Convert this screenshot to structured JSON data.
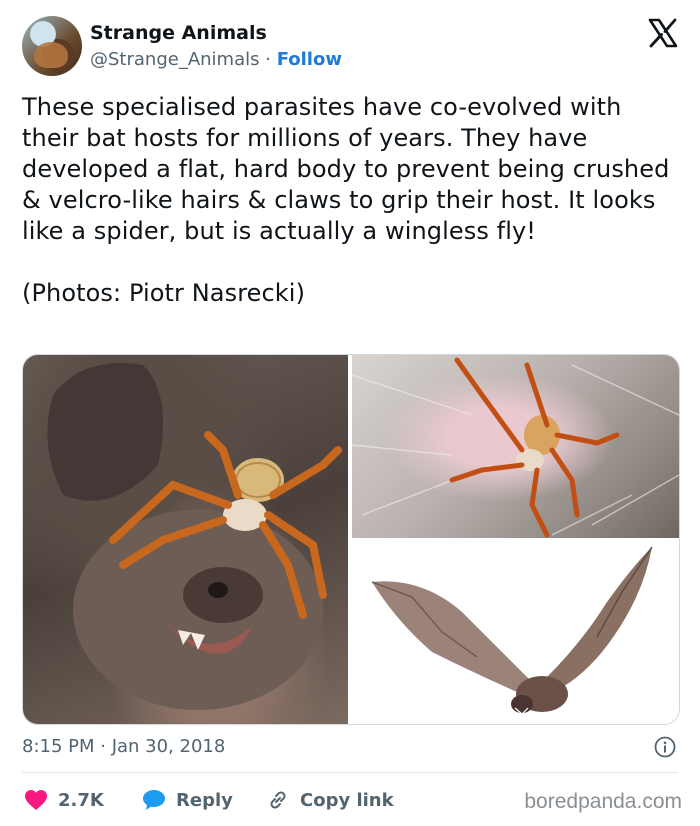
{
  "header": {
    "display_name": "Strange Animals",
    "handle": "@Strange_Animals",
    "separator": "·",
    "follow_label": "Follow"
  },
  "icons": {
    "platform": "x-logo-icon",
    "info": "info-icon",
    "like": "heart-icon",
    "reply": "speech-bubble-icon",
    "copy": "link-icon"
  },
  "tweet": {
    "paragraph1": "These specialised parasites have co-evolved with their bat hosts for millions of years. They have developed a flat, hard body to prevent being crushed & velcro-like hairs & claws to grip their host. It looks like a spider, but is actually a wingless fly!",
    "paragraph2": "(Photos: Piotr Nasrecki)"
  },
  "media": {
    "photos": [
      "bat-fly-on-bat-face",
      "bat-fly-in-fur",
      "flying-bat"
    ]
  },
  "meta": {
    "timestamp": "8:15 PM · Jan 30, 2018"
  },
  "actions": {
    "like_count": "2.7K",
    "reply_label": "Reply",
    "copy_label": "Copy link"
  },
  "watermark": "boredpanda.com",
  "colors": {
    "follow": "#1d7bd6",
    "like": "#f91880",
    "reply": "#1d9bf0",
    "secondary_text": "#536471"
  }
}
